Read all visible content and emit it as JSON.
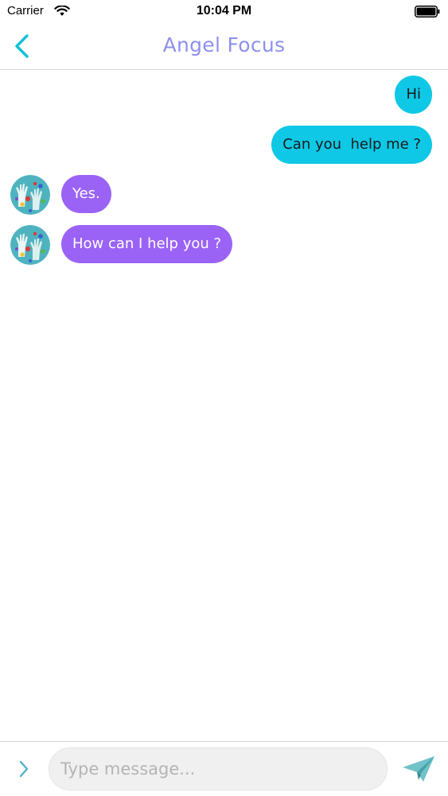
{
  "status_bar": {
    "carrier": "Carrier",
    "time": "10:04 PM"
  },
  "nav": {
    "title": "Angel Focus",
    "back_icon": "chevron-left-icon"
  },
  "messages": [
    {
      "direction": "outgoing",
      "text": "Hi"
    },
    {
      "direction": "outgoing",
      "text": "Can you  help me ?"
    },
    {
      "direction": "incoming",
      "text": "Yes.",
      "avatar": "avatar-hands-icon"
    },
    {
      "direction": "incoming",
      "text": "How can I help you ?",
      "avatar": "avatar-hands-icon"
    }
  ],
  "composer": {
    "placeholder": "Type message...",
    "value": "",
    "expand_icon": "chevron-right-icon",
    "send_icon": "paper-plane-icon"
  },
  "colors": {
    "accent": "#0ec8e6",
    "incoming_bubble": "#9a63f5",
    "title": "#8e90ee",
    "avatar_bg": "#4fb3bf"
  }
}
